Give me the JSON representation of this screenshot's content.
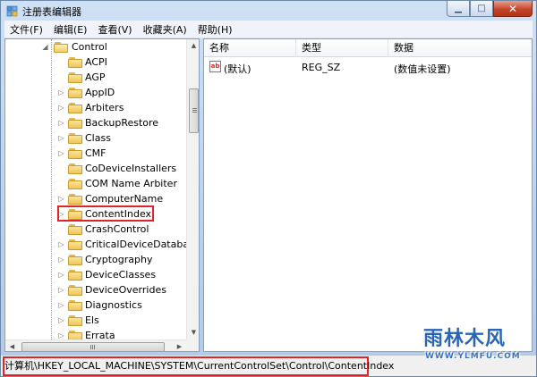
{
  "window": {
    "title": "注册表编辑器",
    "controls": {
      "minimize": "▁",
      "maximize": "□",
      "close": "✕"
    }
  },
  "menu": [
    "文件(F)",
    "编辑(E)",
    "查看(V)",
    "收藏夹(A)",
    "帮助(H)"
  ],
  "tree": {
    "parent": "Control",
    "items": [
      {
        "label": "ACPI",
        "expandable": false
      },
      {
        "label": "AGP",
        "expandable": false
      },
      {
        "label": "AppID",
        "expandable": true
      },
      {
        "label": "Arbiters",
        "expandable": true
      },
      {
        "label": "BackupRestore",
        "expandable": true
      },
      {
        "label": "Class",
        "expandable": true
      },
      {
        "label": "CMF",
        "expandable": true
      },
      {
        "label": "CoDeviceInstallers",
        "expandable": false
      },
      {
        "label": "COM Name Arbiter",
        "expandable": false
      },
      {
        "label": "ComputerName",
        "expandable": true
      },
      {
        "label": "ContentIndex",
        "expandable": true,
        "highlighted": true
      },
      {
        "label": "CrashControl",
        "expandable": false
      },
      {
        "label": "CriticalDeviceDatabase",
        "expandable": true
      },
      {
        "label": "Cryptography",
        "expandable": true
      },
      {
        "label": "DeviceClasses",
        "expandable": true
      },
      {
        "label": "DeviceOverrides",
        "expandable": true
      },
      {
        "label": "Diagnostics",
        "expandable": true
      },
      {
        "label": "Els",
        "expandable": true
      },
      {
        "label": "Errata",
        "expandable": true
      }
    ]
  },
  "list": {
    "columns": [
      "名称",
      "类型",
      "数据"
    ],
    "rows": [
      {
        "icon": "ab",
        "name": "(默认)",
        "type": "REG_SZ",
        "data": "(数值未设置)"
      }
    ]
  },
  "status": {
    "path": "计算机\\HKEY_LOCAL_MACHINE\\SYSTEM\\CurrentControlSet\\Control\\ContentIndex"
  },
  "watermark": {
    "name": "雨林木风",
    "url": "WWW.YLMFU.COM"
  },
  "colors": {
    "highlight_box": "#e0242c",
    "folder": "#efc659",
    "watermark": "#2a64b8"
  }
}
